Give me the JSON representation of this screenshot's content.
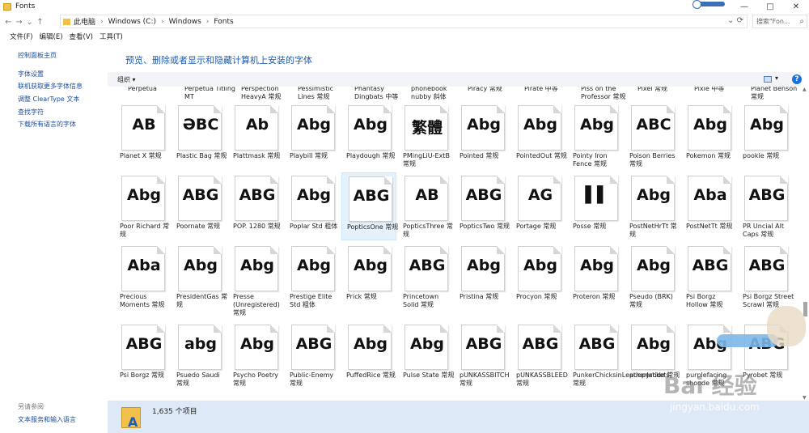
{
  "window": {
    "title": "Fonts",
    "buttons": [
      "—",
      "□",
      "✕"
    ]
  },
  "nav": {
    "back": "←",
    "forward": "→",
    "recent": "⌄",
    "up": "↑",
    "crumbs": [
      "此电脑",
      "Windows (C:)",
      "Windows",
      "Fonts"
    ],
    "refresh": "⟳",
    "dropdown": "⌄",
    "search_placeholder": "搜索\"Fon...",
    "search_icon": "⌕"
  },
  "menu": [
    "文件(F)",
    "编辑(E)",
    "查看(V)",
    "工具(T)"
  ],
  "left_links": [
    "控制面板主页",
    "字体设置",
    "联机获取更多字体信息",
    "调整 ClearType 文本",
    "查找字符",
    "下载所有语言的字体"
  ],
  "see_also": {
    "title": "另请参阅",
    "link": "文本服务和输入语言"
  },
  "header_text": "预览、删除或者显示和隐藏计算机上安装的字体",
  "toolbar": {
    "organize": "组织 ▾",
    "view_caret": "▾",
    "help": "?"
  },
  "partial_row": [
    "Perpetua",
    "Perpetua Titling MT",
    "Perspection HeavyA 常规",
    "Pessimistic Lines 常规",
    "Phantasy Dingbats 中等",
    "phonebook nubby 斜体",
    "Piracy 常规",
    "Pirate 中等",
    "Piss on the Professor 常规",
    "Pixel 常规",
    "Pixie 中等",
    "Planet Benson 常规"
  ],
  "rows": [
    [
      {
        "sample": "AB",
        "name": "Planet X 常规"
      },
      {
        "sample": "ƏBC",
        "name": "Plastic Bag 常规"
      },
      {
        "sample": "Ab",
        "name": "Plattmask 常规"
      },
      {
        "sample": "Abg",
        "name": "Playbill 常规"
      },
      {
        "sample": "Abg",
        "name": "Playdough 常规"
      },
      {
        "sample": "繁體",
        "name": "PMingLiU-ExtB 常规"
      },
      {
        "sample": "Abg",
        "name": "Pointed 常规"
      },
      {
        "sample": "Abg",
        "name": "PointedOut 常规"
      },
      {
        "sample": "Abg",
        "name": "Pointy Iron Fence 常规"
      },
      {
        "sample": "ABC",
        "name": "Poison Berries 常规"
      },
      {
        "sample": "Abg",
        "name": "Pokemon 常规"
      },
      {
        "sample": "Abg",
        "name": "pookie 常规"
      }
    ],
    [
      {
        "sample": "Abg",
        "name": "Poor Richard 常规"
      },
      {
        "sample": "ABG",
        "name": "Poornate 常规"
      },
      {
        "sample": "ABG",
        "name": "POP. 1280 常规"
      },
      {
        "sample": "Abg",
        "name": "Poplar Std 粗体"
      },
      {
        "sample": "ABG",
        "name": "PopticsOne 常规"
      },
      {
        "sample": "AB",
        "name": "PopticsThree 常规"
      },
      {
        "sample": "ABG",
        "name": "PopticsTwo 常规"
      },
      {
        "sample": "AG",
        "name": "Portage 常规"
      },
      {
        "sample": "▌▌",
        "name": "Posse 常规"
      },
      {
        "sample": "Abg",
        "name": "PostNetHrTt 常规"
      },
      {
        "sample": "Aba",
        "name": "PostNetTt 常规"
      },
      {
        "sample": "ABG",
        "name": "PR Uncial Alt Caps 常规"
      }
    ],
    [
      {
        "sample": "Aba",
        "name": "Precious Moments 常规"
      },
      {
        "sample": "Abg",
        "name": "PresidentGas 常规"
      },
      {
        "sample": "Abg",
        "name": "Presse (Unregistered) 常规"
      },
      {
        "sample": "Abg",
        "name": "Prestige Elite Std 粗体"
      },
      {
        "sample": "Abg",
        "name": "Prick 常规"
      },
      {
        "sample": "ABG",
        "name": "Princetown Solid 常规"
      },
      {
        "sample": "Abg",
        "name": "Pristina 常规"
      },
      {
        "sample": "Abg",
        "name": "Procyon 常规"
      },
      {
        "sample": "Abg",
        "name": "Proteron 常规"
      },
      {
        "sample": "Abg",
        "name": "Pseudo (BRK) 常规"
      },
      {
        "sample": "ABG",
        "name": "Psi Borgz Hollow 常规"
      },
      {
        "sample": "ABG",
        "name": "Psi Borgz Street Scrawl 常规"
      }
    ],
    [
      {
        "sample": "ABG",
        "name": "Psi Borgz 常规"
      },
      {
        "sample": "abg",
        "name": "Psuedo Saudi 常规"
      },
      {
        "sample": "Abg",
        "name": "Psycho Poetry 常规"
      },
      {
        "sample": "ABG",
        "name": "Public-Enemy 常规"
      },
      {
        "sample": "Abg",
        "name": "PuffedRice 常规"
      },
      {
        "sample": "Abg",
        "name": "Pulse State 常规"
      },
      {
        "sample": "ABG",
        "name": "pUNKASSBITCH 常规"
      },
      {
        "sample": "ABG",
        "name": "pUNKASSBLEED 常规"
      },
      {
        "sample": "ABG",
        "name": "PunkerChicksinLeatherJackets 常规"
      },
      {
        "sample": "Abg",
        "name": "puopertide 常规"
      },
      {
        "sample": "Abg",
        "name": "purplefacing shoode 常规"
      },
      {
        "sample": "ABG",
        "name": "Pyrobet 常规"
      }
    ]
  ],
  "selected_font": "PopticsOne 常规",
  "status": {
    "count": "1,635 个项目"
  },
  "watermark": {
    "sign": "Bai 经验",
    "url": "jingyan.baidu.com"
  },
  "colors": {
    "link": "#1b4d9b",
    "header": "#1f5cb3",
    "details_bg": "#dde9f7",
    "selected": "#e5f1fb"
  }
}
